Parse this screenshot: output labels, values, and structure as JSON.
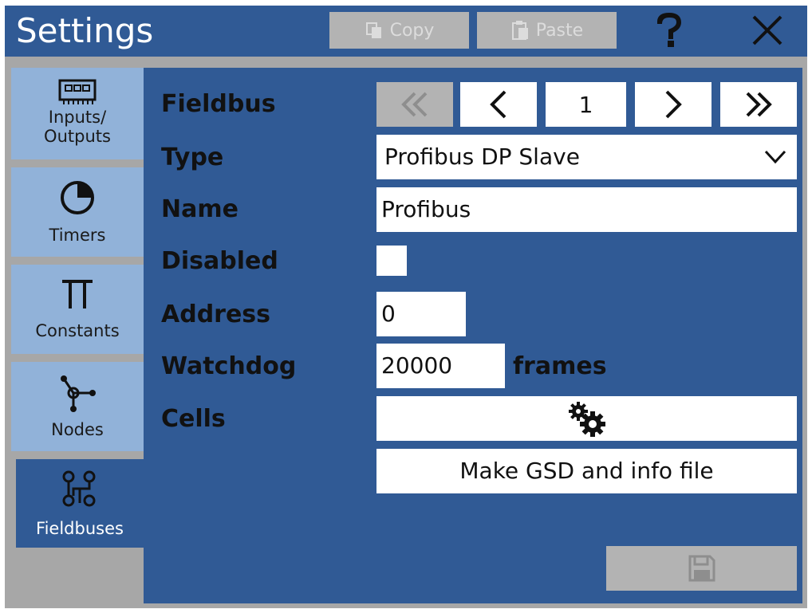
{
  "window": {
    "title": "Settings",
    "copy_label": "Copy",
    "paste_label": "Paste"
  },
  "sidebar": {
    "items": [
      {
        "label_line1": "Inputs/",
        "label_line2": "Outputs",
        "icon": "io-module-icon"
      },
      {
        "label": "Timers",
        "icon": "timer-icon"
      },
      {
        "label": "Constants",
        "icon": "pi-icon"
      },
      {
        "label": "Nodes",
        "icon": "nodes-icon"
      },
      {
        "label": "Fieldbuses",
        "icon": "fieldbus-network-icon",
        "active": true
      }
    ]
  },
  "form": {
    "fieldbus_label": "Fieldbus",
    "fieldbus_index": "1",
    "type_label": "Type",
    "type_value": "Profibus DP Slave",
    "name_label": "Name",
    "name_value": "Profibus",
    "disabled_label": "Disabled",
    "disabled_checked": false,
    "address_label": "Address",
    "address_value": "0",
    "watchdog_label": "Watchdog",
    "watchdog_value": "20000",
    "watchdog_unit": "frames",
    "cells_label": "Cells",
    "make_gsd_label": "Make GSD and info file"
  },
  "colors": {
    "panel_blue": "#305a95",
    "tab_light_blue": "#91b2d9",
    "disabled_gray": "#b3b3b3"
  }
}
